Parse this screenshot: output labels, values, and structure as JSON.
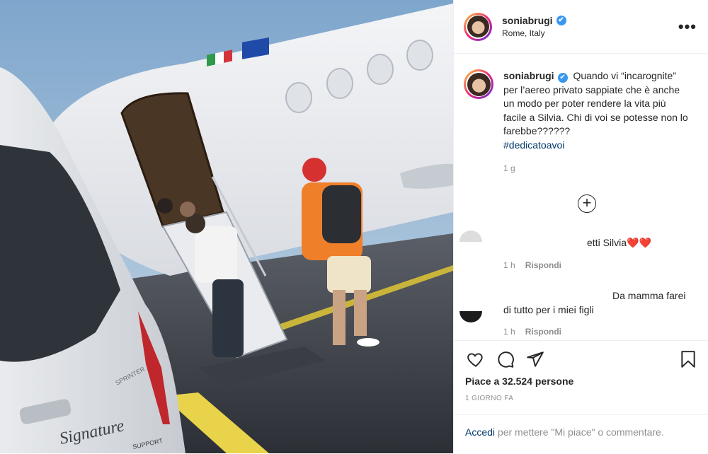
{
  "post": {
    "username": "soniabrugi",
    "verified_mark": "✔",
    "location": "Rome, Italy",
    "more_icon": "more-horizontal-icon",
    "more_label": "•••"
  },
  "caption": {
    "username": "soniabrugi",
    "text": "Quando vi “incarognite” per l’aereo privato sappiate che è anche un modo per poter rendere la vita più facile a Silvia. Chi di voi se potesse non lo farebbe??????",
    "hashtag": "#dedicatoavoi",
    "time": "1 g"
  },
  "load_more_label": "+",
  "comments": [
    {
      "text": "etti Silvia❤️❤️",
      "time": "1 h",
      "reply_label": "Rispondi"
    },
    {
      "text_line1": "Da mamma farei",
      "text_line2": "di tutto per i miei figli",
      "time": "1 h",
      "reply_label": "Rispondi"
    }
  ],
  "actions": {
    "like_icon": "heart-icon",
    "comment_icon": "comment-icon",
    "share_icon": "paper-plane-icon",
    "save_icon": "bookmark-icon",
    "likes_text": "Piace a 32.524 persone",
    "date_text": "1 GIORNO FA"
  },
  "login": {
    "link_text": "Accedi",
    "rest_text": " per mettere \"Mi piace\" o commentare."
  },
  "photo": {
    "van_brand": "Signature",
    "van_sub": "SUPPORT",
    "van_badge": "SPRINTER"
  },
  "colors": {
    "verified": "#3897f0",
    "link": "#00376b",
    "secondary": "#8e8e8e"
  }
}
